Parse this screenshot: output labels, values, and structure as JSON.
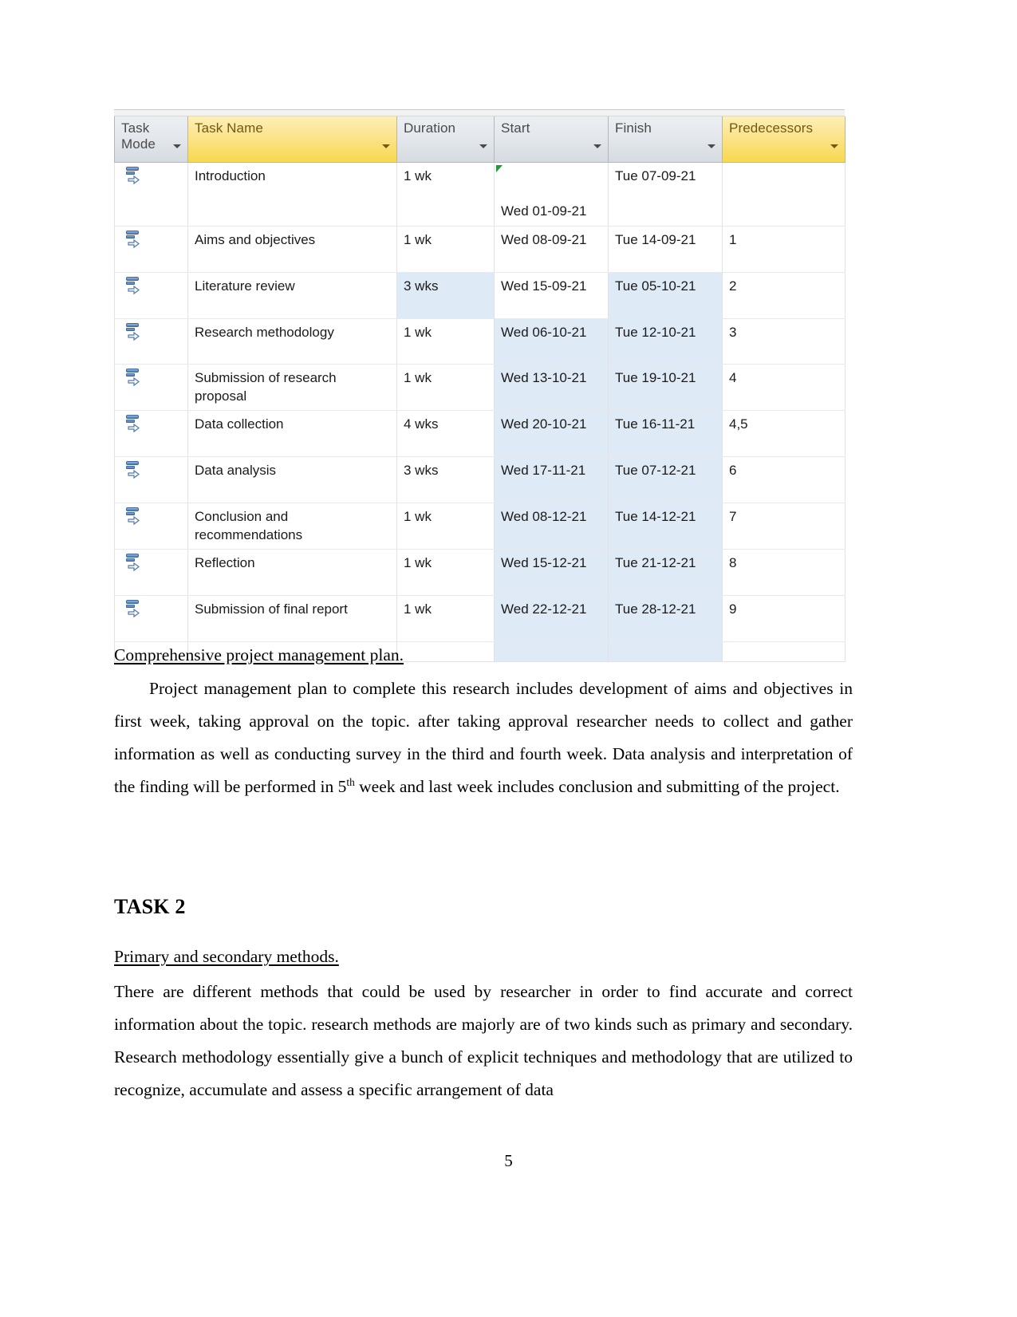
{
  "document": {
    "page_number": "5",
    "gantt_table": {
      "columns": [
        {
          "key": "task_mode",
          "label": "Task\nMode",
          "highlighted": false,
          "has_filter_arrow": true
        },
        {
          "key": "task_name",
          "label": "Task Name",
          "highlighted": true,
          "has_filter_arrow": true
        },
        {
          "key": "duration",
          "label": "Duration",
          "highlighted": false,
          "has_filter_arrow": true
        },
        {
          "key": "start",
          "label": "Start",
          "highlighted": false,
          "has_filter_arrow": true
        },
        {
          "key": "finish",
          "label": "Finish",
          "highlighted": false,
          "has_filter_arrow": true
        },
        {
          "key": "predecessors",
          "label": "Predecessors",
          "highlighted": true,
          "has_filter_arrow": true
        }
      ],
      "rows": [
        {
          "task_mode": "",
          "task_name": "Introduction",
          "duration": "1 wk",
          "start": "Wed 01-09-21",
          "finish": "Tue 07-09-21",
          "predecessors": "",
          "selected": []
        },
        {
          "task_mode": "",
          "task_name": "Aims and objectives",
          "duration": "1 wk",
          "start": "Wed 08-09-21",
          "finish": "Tue 14-09-21",
          "predecessors": "1",
          "selected": []
        },
        {
          "task_mode": "",
          "task_name": "Literature review",
          "duration": "3 wks",
          "start": "Wed 15-09-21",
          "finish": "Tue 05-10-21",
          "predecessors": "2",
          "selected": [
            "duration",
            "finish"
          ]
        },
        {
          "task_mode": "",
          "task_name": "Research methodology",
          "duration": "1 wk",
          "start": "Wed 06-10-21",
          "finish": "Tue 12-10-21",
          "predecessors": "3",
          "selected": [
            "start",
            "finish"
          ]
        },
        {
          "task_mode": "",
          "task_name": "Submission of research\nproposal",
          "duration": "1 wk",
          "start": "Wed 13-10-21",
          "finish": "Tue 19-10-21",
          "predecessors": "4",
          "selected": [
            "start",
            "finish"
          ]
        },
        {
          "task_mode": "",
          "task_name": "Data collection",
          "duration": "4 wks",
          "start": "Wed 20-10-21",
          "finish": "Tue 16-11-21",
          "predecessors": "4,5",
          "selected": [
            "start",
            "finish"
          ]
        },
        {
          "task_mode": "",
          "task_name": "Data analysis",
          "duration": "3 wks",
          "start": "Wed 17-11-21",
          "finish": "Tue 07-12-21",
          "predecessors": "6",
          "selected": [
            "start",
            "finish"
          ]
        },
        {
          "task_mode": "",
          "task_name": "Conclusion and\nrecommendations",
          "duration": "1 wk",
          "start": "Wed 08-12-21",
          "finish": "Tue 14-12-21",
          "predecessors": "7",
          "selected": [
            "start",
            "finish"
          ]
        },
        {
          "task_mode": "",
          "task_name": "Reflection",
          "duration": "1 wk",
          "start": "Wed 15-12-21",
          "finish": "Tue 21-12-21",
          "predecessors": "8",
          "selected": [
            "start",
            "finish"
          ]
        },
        {
          "task_mode": "",
          "task_name": "Submission of final report",
          "duration": "1 wk",
          "start": "Wed 22-12-21",
          "finish": "Tue 28-12-21",
          "predecessors": "9",
          "selected": [
            "start",
            "finish"
          ]
        }
      ],
      "colors": {
        "header_gray": "#e3e7ec",
        "header_yellow": "#fbe180",
        "selection_blue": "#dfeaf7",
        "grid_line": "#dfe3e8",
        "start_marker_green": "#1f9a3a",
        "task_mode_icon_blue": "#4f79b0"
      }
    },
    "sections": {
      "plan_heading": "Comprehensive project management plan.",
      "plan_paragraph_a": "Project management plan to complete this research includes development of aims and objectives in first week, taking approval on the topic. after taking approval researcher needs to collect and gather information as well as conducting survey in the third and fourth week. Data analysis and interpretation of the finding will be performed in 5",
      "plan_paragraph_sup": "th",
      "plan_paragraph_b": " week and last week includes conclusion and submitting of the project.",
      "task2_heading": "TASK 2",
      "methods_heading": "Primary and secondary methods.",
      "methods_paragraph": "There are different methods that could be used by researcher in order to find accurate and correct information about the topic. research methods are majorly are of two kinds such as primary and secondary. Research methodology essentially give a bunch of explicit techniques and methodology that are utilized to recognize, accumulate and assess a specific arrangement of data"
    }
  }
}
